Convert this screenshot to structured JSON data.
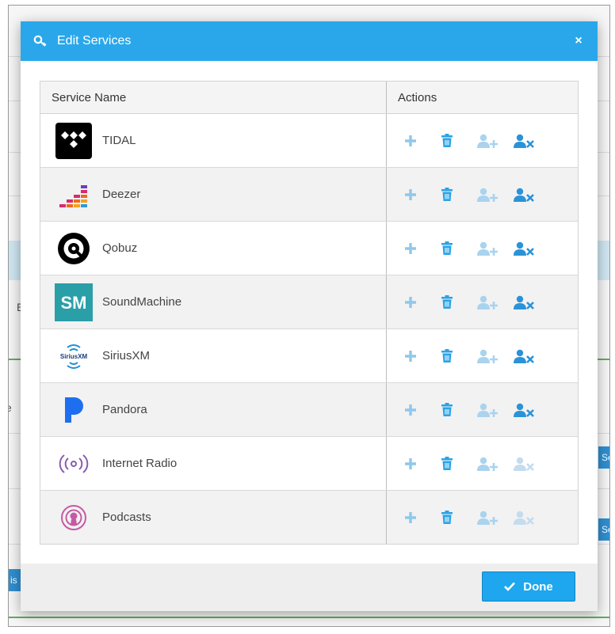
{
  "modal": {
    "title": "Edit Services",
    "close_label": "×",
    "done_label": "Done"
  },
  "table": {
    "headers": {
      "name": "Service Name",
      "actions": "Actions"
    },
    "rows": [
      {
        "name": "TIDAL",
        "icon": "tidal-logo-icon",
        "user_remove_enabled": true
      },
      {
        "name": "Deezer",
        "icon": "deezer-logo-icon",
        "user_remove_enabled": true
      },
      {
        "name": "Qobuz",
        "icon": "qobuz-logo-icon",
        "user_remove_enabled": true
      },
      {
        "name": "SoundMachine",
        "icon": "soundmachine-logo-icon",
        "user_remove_enabled": true
      },
      {
        "name": "SiriusXM",
        "icon": "siriusxm-logo-icon",
        "user_remove_enabled": true
      },
      {
        "name": "Pandora",
        "icon": "pandora-logo-icon",
        "user_remove_enabled": true
      },
      {
        "name": "Internet Radio",
        "icon": "internet-radio-icon",
        "user_remove_enabled": false
      },
      {
        "name": "Podcasts",
        "icon": "podcasts-icon",
        "user_remove_enabled": false
      }
    ]
  },
  "logos": {
    "soundmachine_text": "SM",
    "siriusxm_text": "SiriusXM"
  },
  "background": {
    "fragments": [
      "E",
      "e",
      "Se",
      "Se",
      "is"
    ]
  },
  "colors": {
    "header": "#2aa7ea",
    "done_button": "#1ea6ee",
    "add_icon": "#8fc8ea",
    "trash_icon": "#2aa3e6",
    "user_add_icon": "#a9d3ef",
    "user_remove_icon": "#2a93d8",
    "user_remove_disabled": "#c3dcee"
  }
}
